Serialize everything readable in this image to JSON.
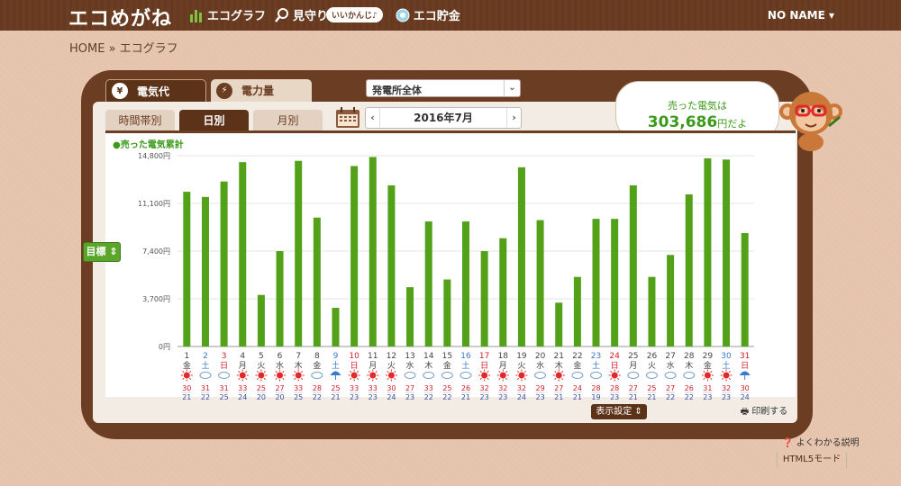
{
  "app": {
    "logo": "エコめがね",
    "nav": [
      {
        "label": "エコグラフ",
        "icon": "bar-chart-icon"
      },
      {
        "label": "見守り",
        "icon": "magnifier-icon",
        "badge": "いいかんじ♪"
      },
      {
        "label": "エコ貯金",
        "icon": "coin-icon"
      }
    ],
    "user": "NO NAME ▾"
  },
  "breadcrumb": "HOME » エコグラフ",
  "tabs_top": [
    {
      "label": "電気代",
      "icon": "¥"
    },
    {
      "label": "電力量",
      "icon": "⚡"
    }
  ],
  "select_main": "発電所全体",
  "tabs_sub": [
    "時間帯別",
    "日別",
    "月別"
  ],
  "date_display": "2016年7月",
  "sold": {
    "label": "売った電気は",
    "value": "303,686",
    "unit": "円だよ"
  },
  "goal_button": "目標 ⇕",
  "footer": {
    "display_settings": "表示設定 ⇕",
    "print": "印刷する",
    "help": "よくわかる説明",
    "html5": "HTML5モード"
  },
  "colors": {
    "bar": "#52a118",
    "brown": "#6b3d22",
    "sunday": "#d0202a",
    "saturday": "#3a7ac8",
    "high_temp": "#d0202a",
    "low_temp": "#3a50a8"
  },
  "chart_data": {
    "type": "bar",
    "title": "●売った電気累計",
    "ylabel": "",
    "ylim": [
      0,
      14800
    ],
    "yticks": [
      "0円",
      "3,700円",
      "7,400円",
      "11,100円",
      "14,800円"
    ],
    "ytick_values": [
      0,
      3700,
      7400,
      11100,
      14800
    ],
    "days": [
      "1",
      "2",
      "3",
      "4",
      "5",
      "6",
      "7",
      "8",
      "9",
      "10",
      "11",
      "12",
      "13",
      "14",
      "15",
      "16",
      "17",
      "18",
      "19",
      "20",
      "21",
      "22",
      "23",
      "24",
      "25",
      "26",
      "27",
      "28",
      "29",
      "30",
      "31"
    ],
    "weekdays": [
      "金",
      "土",
      "日",
      "月",
      "火",
      "水",
      "木",
      "金",
      "土",
      "日",
      "月",
      "火",
      "水",
      "木",
      "金",
      "土",
      "日",
      "月",
      "火",
      "水",
      "木",
      "金",
      "土",
      "日",
      "月",
      "火",
      "水",
      "木",
      "金",
      "土",
      "日"
    ],
    "values": [
      12000,
      11600,
      12800,
      14300,
      4000,
      7400,
      14400,
      10000,
      3000,
      14000,
      14700,
      12500,
      4600,
      9700,
      5200,
      9700,
      7400,
      8400,
      13900,
      9800,
      3400,
      5400,
      9900,
      9900,
      12500,
      5400,
      7100,
      11800,
      14600,
      14500,
      8800
    ],
    "weather": [
      "sun",
      "cloud",
      "cloud",
      "sun",
      "sun",
      "sun",
      "sun",
      "cloud",
      "rain",
      "sun",
      "sun",
      "sun",
      "cloud",
      "cloud",
      "cloud",
      "cloud",
      "sun",
      "sun",
      "sun",
      "cloud",
      "sun",
      "cloud",
      "cloud",
      "sun",
      "cloud",
      "cloud",
      "cloud",
      "cloud",
      "sun",
      "sun",
      "rain"
    ],
    "high_temps": [
      "30",
      "31",
      "31",
      "33",
      "25",
      "27",
      "33",
      "28",
      "25",
      "33",
      "33",
      "30",
      "27",
      "33",
      "25",
      "26",
      "32",
      "32",
      "32",
      "29",
      "27",
      "24",
      "28",
      "28",
      "27",
      "25",
      "27",
      "26",
      "31",
      "32",
      "30"
    ],
    "low_temps": [
      "21",
      "22",
      "25",
      "24",
      "20",
      "20",
      "25",
      "22",
      "21",
      "23",
      "23",
      "24",
      "23",
      "22",
      "22",
      "21",
      "23",
      "23",
      "24",
      "23",
      "21",
      "21",
      "19",
      "23",
      "21",
      "21",
      "22",
      "22",
      "23",
      "23",
      "24"
    ]
  }
}
